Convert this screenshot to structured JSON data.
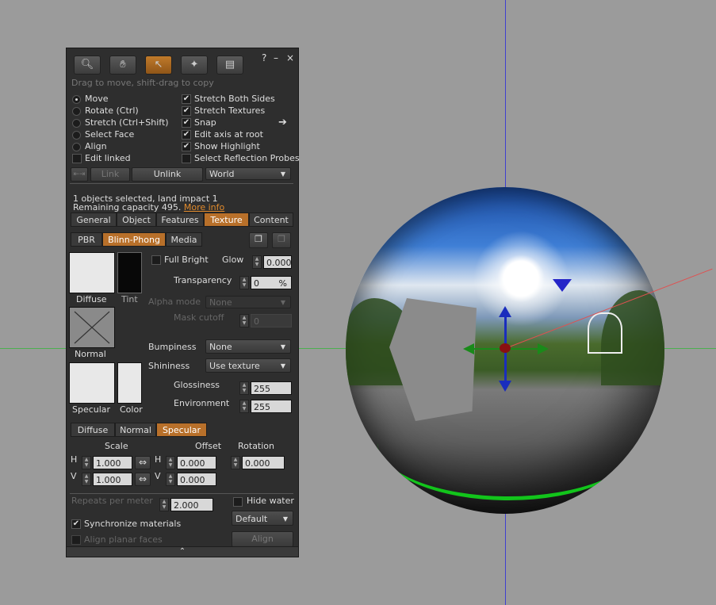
{
  "floater": {
    "hint": "Drag to move, shift-drag to copy",
    "controls": {
      "help": "?",
      "minimize": "–",
      "close": "×"
    },
    "tools": [
      {
        "name": "zoom-tool",
        "icon": "magnifier-icon"
      },
      {
        "name": "grab-tool",
        "icon": "hand-icon"
      },
      {
        "name": "edit-tool",
        "icon": "arrow-cursor-icon",
        "active": true
      },
      {
        "name": "create-tool",
        "icon": "magic-wand-icon"
      },
      {
        "name": "land-tool",
        "icon": "bulldozer-icon"
      }
    ],
    "modes": {
      "move": "Move",
      "rotate": "Rotate (Ctrl)",
      "stretch": "Stretch (Ctrl+Shift)",
      "select_face": "Select Face",
      "align": "Align"
    },
    "edit_linked": "Edit linked",
    "options": {
      "stretch_both_sides": "Stretch Both Sides",
      "stretch_textures": "Stretch Textures",
      "snap": "Snap",
      "edit_axis_at_root": "Edit axis at root",
      "show_highlight": "Show Highlight",
      "select_reflection_probes": "Select Reflection Probes"
    },
    "link_label": "Link",
    "unlink_label": "Unlink",
    "ruler_selected": "World",
    "selection_info": "1 objects selected, land impact 1",
    "remaining": "Remaining capacity 495.",
    "more_info": "More info",
    "tabs": [
      "General",
      "Object",
      "Features",
      "Texture",
      "Content"
    ],
    "material_tabs": [
      "PBR",
      "Blinn-Phong",
      "Media"
    ],
    "swatches": {
      "diffuse": "Diffuse",
      "tint": "Tint",
      "normal": "Normal",
      "specular": "Specular",
      "color": "Color"
    },
    "full_bright": "Full Bright",
    "glow_label": "Glow",
    "glow_value": "0.000",
    "transparency_label": "Transparency",
    "transparency_value": "0",
    "transparency_unit": "%",
    "alpha_mode_label": "Alpha mode",
    "alpha_mode_value": "None",
    "mask_cutoff_label": "Mask cutoff",
    "mask_cutoff_value": "0",
    "bumpiness_label": "Bumpiness",
    "bumpiness_value": "None",
    "shininess_label": "Shininess",
    "shininess_value": "Use texture",
    "glossiness_label": "Glossiness",
    "glossiness_value": "255",
    "environment_label": "Environment",
    "environment_value": "255",
    "map_tabs": [
      "Diffuse",
      "Normal",
      "Specular"
    ],
    "scale_label": "Scale",
    "offset_label": "Offset",
    "rotation_label": "Rotation",
    "h": "H",
    "v": "V",
    "scale_h": "1.000",
    "scale_v": "1.000",
    "offset_h": "0.000",
    "offset_v": "0.000",
    "rotation_value": "0.000",
    "repeats_label": "Repeats per meter",
    "repeats_value": "2.000",
    "hide_water": "Hide water",
    "sync_materials": "Synchronize materials",
    "align_planar": "Align planar faces",
    "alignment_select": "Default",
    "align_button": "Align"
  }
}
